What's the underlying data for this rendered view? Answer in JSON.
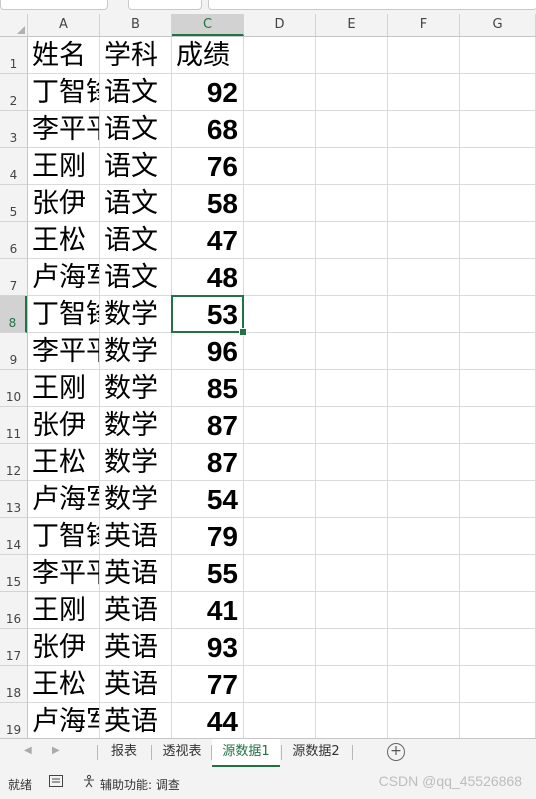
{
  "columns": [
    "A",
    "B",
    "C",
    "D",
    "E",
    "F",
    "G"
  ],
  "active_column": "C",
  "active_row": 8,
  "rows": [
    {
      "row": "1",
      "name": "姓名",
      "subject": "学科",
      "score": "成绩",
      "header": true
    },
    {
      "row": "2",
      "name": "丁智锋",
      "subject": "语文",
      "score": "92"
    },
    {
      "row": "3",
      "name": "李平平",
      "subject": "语文",
      "score": "68"
    },
    {
      "row": "4",
      "name": "王刚",
      "subject": "语文",
      "score": "76"
    },
    {
      "row": "5",
      "name": "张伊",
      "subject": "语文",
      "score": "58"
    },
    {
      "row": "6",
      "name": "王松",
      "subject": "语文",
      "score": "47"
    },
    {
      "row": "7",
      "name": "卢海军",
      "subject": "语文",
      "score": "48"
    },
    {
      "row": "8",
      "name": "丁智锋",
      "subject": "数学",
      "score": "53"
    },
    {
      "row": "9",
      "name": "李平平",
      "subject": "数学",
      "score": "96"
    },
    {
      "row": "10",
      "name": "王刚",
      "subject": "数学",
      "score": "85"
    },
    {
      "row": "11",
      "name": "张伊",
      "subject": "数学",
      "score": "87"
    },
    {
      "row": "12",
      "name": "王松",
      "subject": "数学",
      "score": "87"
    },
    {
      "row": "13",
      "name": "卢海军",
      "subject": "数学",
      "score": "54"
    },
    {
      "row": "14",
      "name": "丁智锋",
      "subject": "英语",
      "score": "79"
    },
    {
      "row": "15",
      "name": "李平平",
      "subject": "英语",
      "score": "55"
    },
    {
      "row": "16",
      "name": "王刚",
      "subject": "英语",
      "score": "41"
    },
    {
      "row": "17",
      "name": "张伊",
      "subject": "英语",
      "score": "93"
    },
    {
      "row": "18",
      "name": "王松",
      "subject": "英语",
      "score": "77"
    },
    {
      "row": "19",
      "name": "卢海军",
      "subject": "英语",
      "score": "44"
    }
  ],
  "sheet_tabs": [
    {
      "label": "报表",
      "active": false
    },
    {
      "label": "透视表",
      "active": false
    },
    {
      "label": "源数据1",
      "active": true
    },
    {
      "label": "源数据2",
      "active": false
    }
  ],
  "statusbar": {
    "ready": "就绪",
    "accessibility": "辅助功能: 调查",
    "watermark": "CSDN @qq_45526868"
  },
  "colors": {
    "accent": "#217346",
    "header_bg": "#f3f3f3",
    "gridline": "#dadada"
  },
  "icons": {
    "nav_prev": "triangle-left",
    "nav_next": "triangle-right",
    "add_sheet": "plus-circle",
    "macro": "sheet-record-icon",
    "accessibility": "accessibility-icon"
  }
}
